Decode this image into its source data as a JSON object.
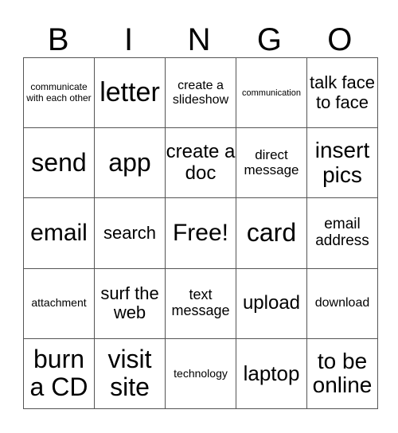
{
  "title_letters": [
    "B",
    "I",
    "N",
    "G",
    "O"
  ],
  "cells": [
    [
      {
        "t": "communicate with each other",
        "s": 12
      },
      {
        "t": "letter",
        "s": 34
      },
      {
        "t": "create a slideshow",
        "s": 16
      },
      {
        "t": "communication",
        "s": 11
      },
      {
        "t": "talk face to face",
        "s": 22
      }
    ],
    [
      {
        "t": "send",
        "s": 32
      },
      {
        "t": "app",
        "s": 32
      },
      {
        "t": "create a doc",
        "s": 24
      },
      {
        "t": "direct message",
        "s": 17
      },
      {
        "t": "insert pics",
        "s": 28
      }
    ],
    [
      {
        "t": "email",
        "s": 30
      },
      {
        "t": "search",
        "s": 22
      },
      {
        "t": "Free!",
        "s": 30
      },
      {
        "t": "card",
        "s": 32
      },
      {
        "t": "email address",
        "s": 19
      }
    ],
    [
      {
        "t": "attachment",
        "s": 14
      },
      {
        "t": "surf the web",
        "s": 22
      },
      {
        "t": "text message",
        "s": 18
      },
      {
        "t": "upload",
        "s": 24
      },
      {
        "t": "download",
        "s": 16
      }
    ],
    [
      {
        "t": "burn a CD",
        "s": 32
      },
      {
        "t": "visit site",
        "s": 32
      },
      {
        "t": "technology",
        "s": 14
      },
      {
        "t": "laptop",
        "s": 26
      },
      {
        "t": "to be online",
        "s": 28
      }
    ]
  ]
}
